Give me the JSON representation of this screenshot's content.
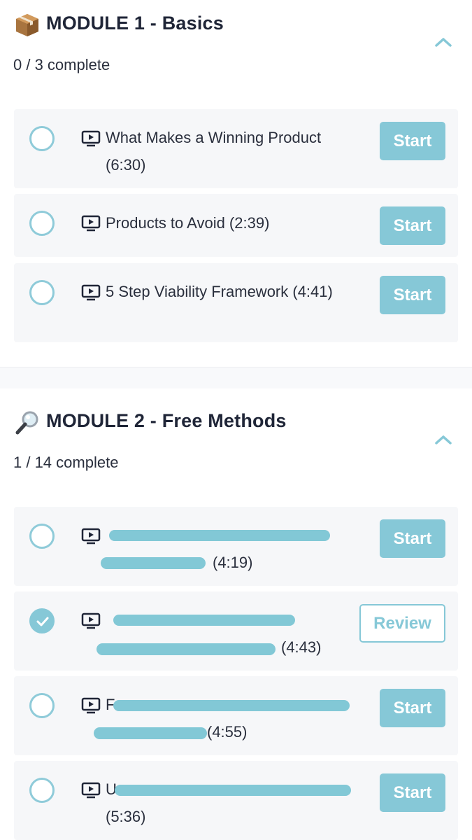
{
  "colors": {
    "accent": "#86c8d7",
    "card_bg": "#f6f7f9",
    "text": "#1f2537"
  },
  "modules": [
    {
      "emoji": "package-icon",
      "title": "MODULE 1 - Basics",
      "progress": "0 / 3 complete",
      "lessons": [
        {
          "title": "What Makes a Winning Product (6:30)",
          "completed": false,
          "button": "Start"
        },
        {
          "title": "Products to Avoid (2:39)",
          "completed": false,
          "button": "Start"
        },
        {
          "title": "5 Step Viability Framework (4:41)",
          "completed": false,
          "button": "Start"
        }
      ]
    },
    {
      "emoji": "magnifier-icon",
      "title": "MODULE 2 - Free Methods",
      "progress": "1 / 14 complete",
      "lessons": [
        {
          "title_visible_end": "(4:19)",
          "completed": false,
          "button": "Start",
          "redacted": true
        },
        {
          "title_visible_end": "(4:43)",
          "completed": true,
          "button": "Review",
          "redacted": true
        },
        {
          "title_visible_start": "F",
          "title_visible_end": "(4:55)",
          "completed": false,
          "button": "Start",
          "redacted": true
        },
        {
          "title_visible_start": "U",
          "title_visible_end": "(5:36)",
          "completed": false,
          "button": "Start",
          "redacted": true
        }
      ]
    }
  ]
}
